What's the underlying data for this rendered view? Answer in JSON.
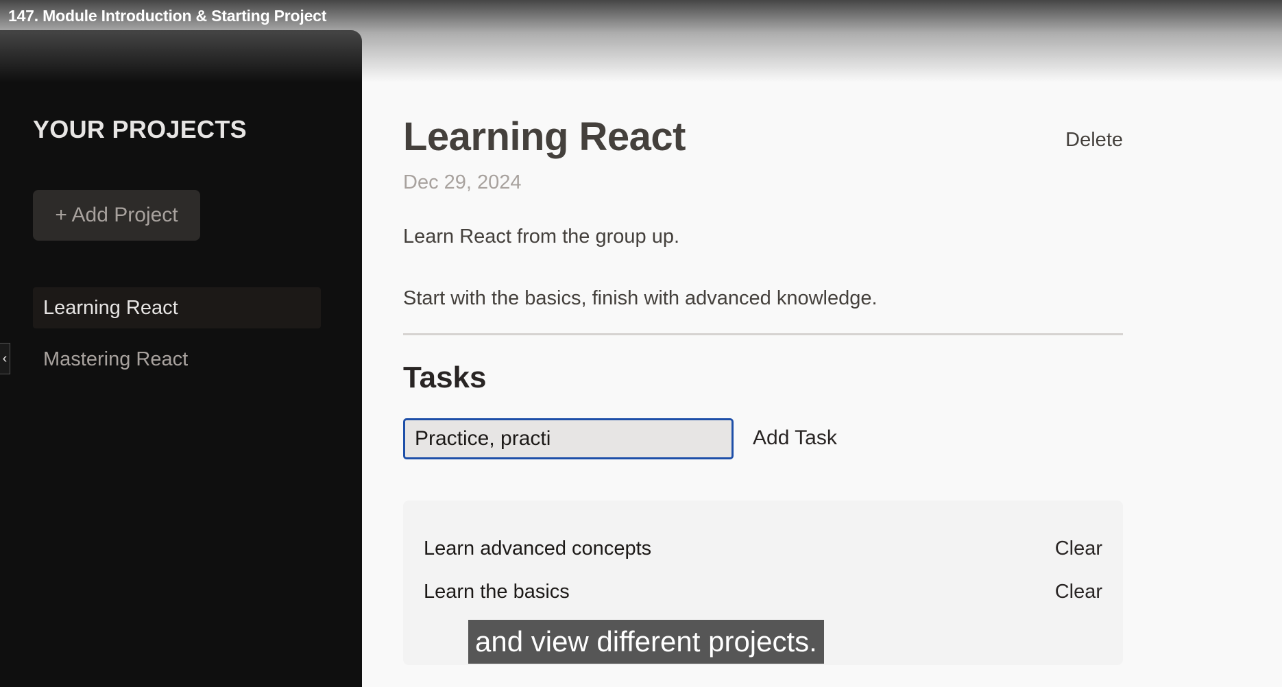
{
  "video": {
    "title": "147. Module Introduction & Starting Project"
  },
  "sidebar": {
    "title": "YOUR PROJECTS",
    "add_button_label": "+ Add Project",
    "collapse_glyph": "‹",
    "projects": [
      {
        "label": "Learning React",
        "selected": true
      },
      {
        "label": "Mastering React",
        "selected": false
      }
    ]
  },
  "project": {
    "title": "Learning React",
    "delete_label": "Delete",
    "date": "Dec 29, 2024",
    "description_lines": [
      "Learn React from the group up.",
      "Start with the basics, finish with advanced knowledge."
    ]
  },
  "tasks": {
    "heading": "Tasks",
    "input_value": "Practice, practi",
    "add_label": "Add Task",
    "items": [
      {
        "text": "Learn advanced concepts",
        "clear_label": "Clear"
      },
      {
        "text": "Learn the basics",
        "clear_label": "Clear"
      }
    ]
  },
  "caption": {
    "text": "and view different projects."
  },
  "colors": {
    "sidebar_bg": "#0f0f0f",
    "main_bg": "#f9f9f9",
    "input_focus_border": "#1e4fa8",
    "task_box_bg": "#f3f3f3"
  }
}
